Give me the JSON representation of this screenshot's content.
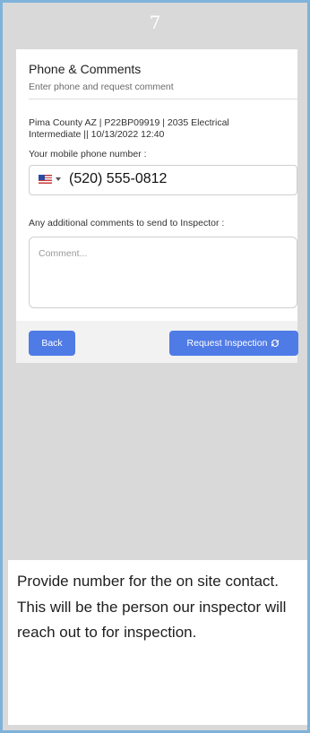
{
  "header": {
    "step_number": "7"
  },
  "form": {
    "title": "Phone & Comments",
    "subtitle": "Enter phone and request comment",
    "info_line1": "Pima County AZ | P22BP09919 | 2035 Electrical",
    "info_line2": "Intermediate || 10/13/2022 12:40",
    "phone_label": "Your mobile phone number :",
    "phone_value": "(520) 555-0812",
    "country_flag": "us-flag-icon",
    "comments_label": "Any additional comments to send to Inspector :",
    "comment_placeholder": "Comment..."
  },
  "actions": {
    "back_label": "Back",
    "request_label": "Request Inspection",
    "button_color": "#4f7be6"
  },
  "note": {
    "text": "Provide number for the on site contact. This will be the person our inspector will reach out to for inspection."
  }
}
